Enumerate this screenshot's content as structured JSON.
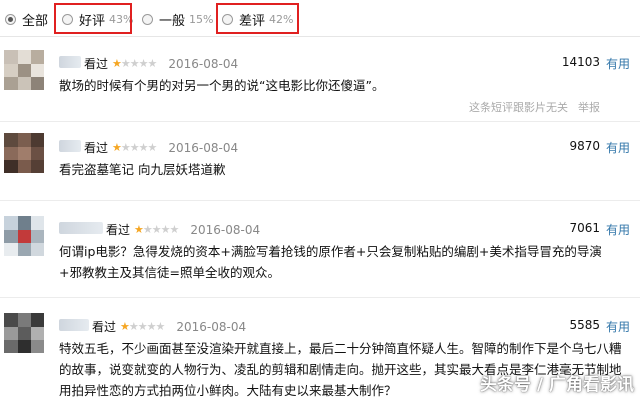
{
  "filters": [
    {
      "label": "全部",
      "pct": "",
      "checked": true
    },
    {
      "label": "好评",
      "pct": "43%",
      "checked": false
    },
    {
      "label": "一般",
      "pct": "15%",
      "checked": false
    },
    {
      "label": "差评",
      "pct": "42%",
      "checked": false
    }
  ],
  "reviews": [
    {
      "seen": "看过",
      "rating": 1,
      "date": "2016-08-04",
      "votes": "14103",
      "useful": "有用",
      "text": "散场的时候有个男的对另一个男的说“这电影比你还傻逼”。",
      "unrelated_link": "这条短评跟影片无关",
      "report_link": "举报"
    },
    {
      "seen": "看过",
      "rating": 1,
      "date": "2016-08-04",
      "votes": "9870",
      "useful": "有用",
      "text": "看完盗墓笔记 向九层妖塔道歉"
    },
    {
      "seen": "看过",
      "rating": 1,
      "date": "2016-08-04",
      "votes": "7061",
      "useful": "有用",
      "text": "何谓ip电影？急得发烧的资本+满脸写着抢钱的原作者+只会复制粘贴的编剧+美术指导冒充的导演+邪教教主及其信徒=照单全收的观众。"
    },
    {
      "seen": "看过",
      "rating": 1,
      "date": "2016-08-04",
      "votes": "5585",
      "useful": "有用",
      "text": "特效五毛，不少画面甚至没渲染开就直接上，最后二十分钟简直怀疑人生。智障的制作下是个乌七八糟的故事，说变就变的人物行为、凌乱的剪辑和剧情走向。抛开这些，其实最大看点是李仁港毫无节制地用拍异性恋的方式拍两位小鲜肉。大陆有史以来最基大制作？"
    }
  ],
  "watermark": "头条号 / 广角看影讯",
  "colors": {
    "accent_link": "#3377aa",
    "star_on": "#f5a623",
    "highlight_box": "#e02020"
  }
}
